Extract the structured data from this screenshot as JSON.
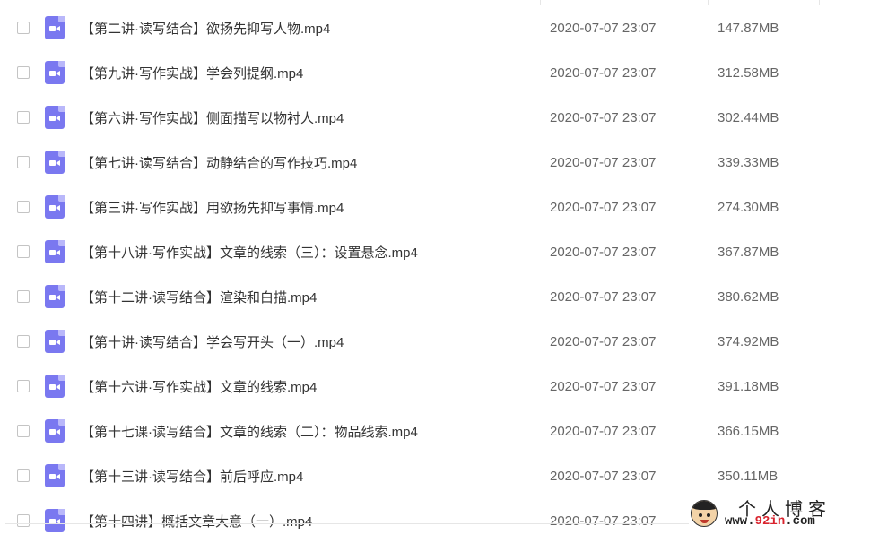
{
  "files": [
    {
      "name": "【第二讲·读写结合】欲扬先抑写人物.mp4",
      "modified": "2020-07-07 23:07",
      "size": "147.87MB"
    },
    {
      "name": "【第九讲·写作实战】学会列提纲.mp4",
      "modified": "2020-07-07 23:07",
      "size": "312.58MB"
    },
    {
      "name": "【第六讲·写作实战】侧面描写以物衬人.mp4",
      "modified": "2020-07-07 23:07",
      "size": "302.44MB"
    },
    {
      "name": "【第七讲·读写结合】动静结合的写作技巧.mp4",
      "modified": "2020-07-07 23:07",
      "size": "339.33MB"
    },
    {
      "name": "【第三讲·写作实战】用欲扬先抑写事情.mp4",
      "modified": "2020-07-07 23:07",
      "size": "274.30MB"
    },
    {
      "name": "【第十八讲·写作实战】文章的线索（三）：设置悬念.mp4",
      "modified": "2020-07-07 23:07",
      "size": "367.87MB"
    },
    {
      "name": "【第十二讲·读写结合】渲染和白描.mp4",
      "modified": "2020-07-07 23:07",
      "size": "380.62MB"
    },
    {
      "name": "【第十讲·读写结合】学会写开头（一）.mp4",
      "modified": "2020-07-07 23:07",
      "size": "374.92MB"
    },
    {
      "name": "【第十六讲·写作实战】文章的线索.mp4",
      "modified": "2020-07-07 23:07",
      "size": "391.18MB"
    },
    {
      "name": "【第十七课·读写结合】文章的线索（二）：物品线索.mp4",
      "modified": "2020-07-07 23:07",
      "size": "366.15MB"
    },
    {
      "name": "【第十三讲·读写结合】前后呼应.mp4",
      "modified": "2020-07-07 23:07",
      "size": "350.11MB"
    },
    {
      "name": "【第十四讲】概括文章大意（一）.mp4",
      "modified": "2020-07-07 23:07",
      "size": ""
    }
  ],
  "icon": "video-file-icon",
  "colors": {
    "icon": "#7a78f0",
    "text": "#333333",
    "meta": "#666666"
  },
  "watermark": {
    "title": "个人博客",
    "url_prefix": "www.",
    "url_highlight": "92in",
    "url_suffix": ".com"
  }
}
